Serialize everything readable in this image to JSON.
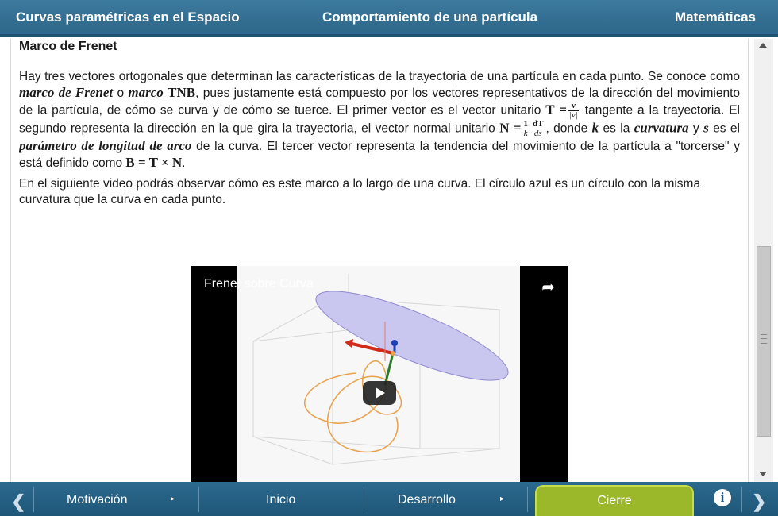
{
  "header": {
    "left": "Curvas paramétricas en el Espacio",
    "center": "Comportamiento de una partícula",
    "right": "Matemáticas"
  },
  "section": {
    "title": "Marco de Frenet",
    "p1": {
      "t1": "Hay tres vectores ortogonales que determinan las características de la trayectoria de una partícula en cada punto. Se conoce como ",
      "m1": "marco de Frenet",
      "t2": " o ",
      "m2": "marco",
      "m3": "TNB",
      "t3": ", pues justamente está compuesto por los vectores representativos de la dirección del movimiento de la partícula, de cómo se curva y de cómo se tuerce. El primer vector es el vector unitario ",
      "eqT": "T =",
      "fracT_num": "v",
      "fracT_den": "|v|",
      "t4": " tangente a la trayectoria. El segundo representa la dirección en la que gira la trayectoria, el vector normal unitario ",
      "eqN": "N =",
      "fracN1_num": "1",
      "fracN1_den": "k",
      "fracN2_num": "dT",
      "fracN2_den": "ds",
      "t5": ", donde ",
      "k": "k",
      "t6": " es la ",
      "curv": "curvatura",
      "t7": " y ",
      "s": "s",
      "t8": " es el ",
      "param": "parámetro de longitud de arco",
      "t9": " de la curva. El tercer vector representa la tendencia del movimiento de la partícula a \"torcerse\" y está definido como ",
      "eqB": "B = T × N",
      "t10": "."
    },
    "p2": "En el siguiente video podrás observar cómo es este marco a lo largo de una curva. El círculo azul es un círculo con la misma curvatura que la curva en cada punto."
  },
  "video": {
    "title": "Frenet sobre Curva"
  },
  "footer": {
    "items": [
      "Motivación",
      "Inicio",
      "Desarrollo",
      "Cierre"
    ],
    "active": "Cierre",
    "info_label": "i"
  },
  "colors": {
    "header_bg": "#2d6688",
    "footer_bg": "#1e5678",
    "active_tab": "#9ab82a",
    "ellipse_fill": "#c9c6ef",
    "curve": "#e8a24a"
  },
  "icons": {
    "share": "share-arrow-icon",
    "play": "play-icon",
    "prev": "chevron-left-icon",
    "next": "chevron-right-icon",
    "info": "info-icon"
  }
}
